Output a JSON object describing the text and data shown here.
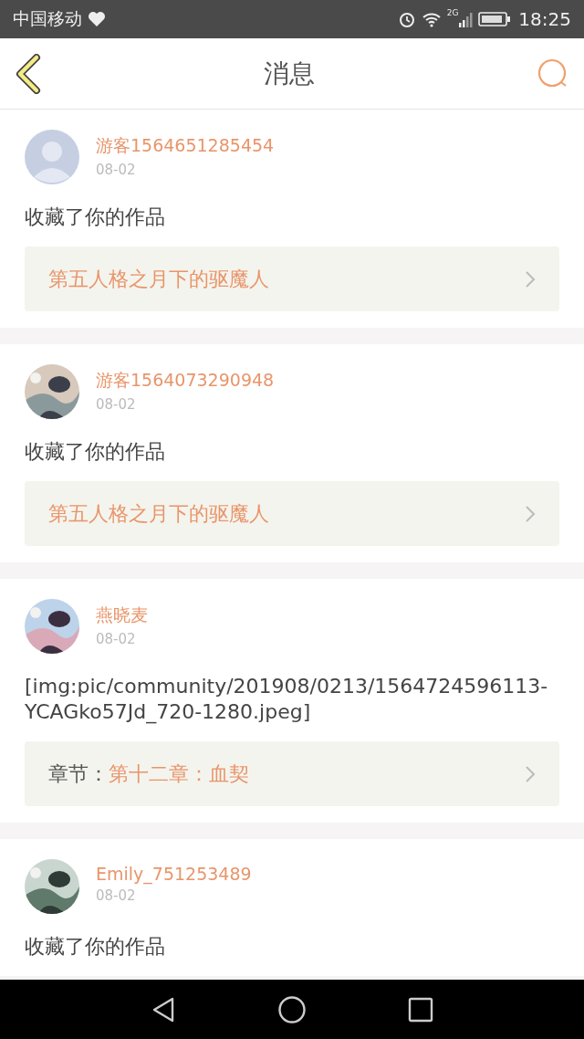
{
  "status_bar": {
    "carrier": "中国移动",
    "time": "18:25",
    "network": "2G"
  },
  "header": {
    "title": "消息"
  },
  "messages": [
    {
      "avatar": {
        "kind": "default"
      },
      "user": "游客1564651285454",
      "date": "08-02",
      "content": "收藏了你的作品",
      "link": {
        "kind": "work",
        "title": "第五人格之月下的驱魔人"
      }
    },
    {
      "user": "游客1564073290948",
      "date": "08-02",
      "content": "收藏了你的作品",
      "link": {
        "kind": "work",
        "title": "第五人格之月下的驱魔人"
      }
    },
    {
      "user": "燕晓麦",
      "date": "08-02",
      "content": "[img:pic/community/201908/0213/1564724596113-YCAGko57Jd_720-1280.jpeg]",
      "link": {
        "kind": "chapter",
        "label": "章节：",
        "title": "第十二章：血契"
      }
    },
    {
      "user": "Emily_751253489",
      "date": "08-02",
      "content": "收藏了你的作品"
    }
  ]
}
